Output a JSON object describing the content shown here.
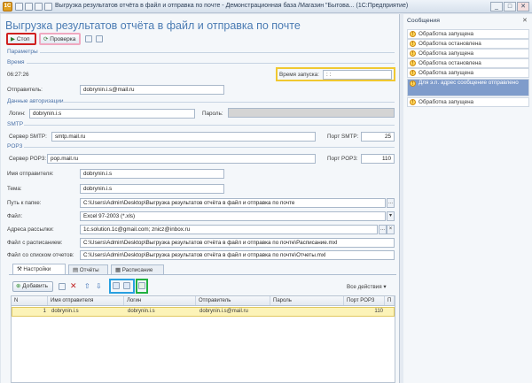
{
  "window": {
    "title": "Выгрузка результатов отчёта в файл и отправка по почте - Демонстрационная база /Магазин \"Бытова...  (1С:Предприятие)",
    "app_icon": "1С",
    "min": "_",
    "max": "□",
    "close": "✕"
  },
  "form": {
    "title": "Выгрузка результатов отчёта в файл и отправка по почте",
    "stop_button": "Стоп",
    "check_button": "Проверка",
    "params_section": "Параметры",
    "time_section": "Время",
    "current_time": "06:27:26",
    "start_time_label": "Время запуска:",
    "start_time_value": ":  :",
    "sender_label": "Отправитель:",
    "sender_value": "dobrynin.i.s@mail.ru",
    "auth_section": "Данные авторизации",
    "login_label": "Логин:",
    "login_value": "dobrynin.i.s",
    "password_label": "Пароль:",
    "smtp_section": "SMTP",
    "smtp_server_label": "Сервер SMTP:",
    "smtp_server_value": "smtp.mail.ru",
    "smtp_port_label": "Порт SMTP:",
    "smtp_port_value": "25",
    "pop3_section": "POP3",
    "pop3_server_label": "Сервер POP3:",
    "pop3_server_value": "pop.mail.ru",
    "pop3_port_label": "Порт POP3:",
    "pop3_port_value": "110",
    "sender_name_label": "Имя отправителя:",
    "sender_name_value": "dobrynin.i.s",
    "subject_label": "Тема:",
    "subject_value": "dobrynin.i.s",
    "folder_label": "Путь к папке:",
    "folder_value": "C:\\Users\\Admin\\Desktop\\Выгрузка результатов отчёта в файл и отправка по почте",
    "file_label": "Файл:",
    "file_value": "Excel 97-2003 (*.xls)",
    "recipients_label": "Адреса рассылки:",
    "recipients_value": "1c.solution.1c@gmail.com;  znicz@inbox.ru",
    "schedule_file_label": "Файл с расписанием:",
    "schedule_file_value": "C:\\Users\\Admin\\Desktop\\Выгрузка результатов отчёта в файл и отправка по почте\\Расписание.mxl",
    "reports_file_label": "Файл со списком отчетов:",
    "reports_file_value": "C:\\Users\\Admin\\Desktop\\Выгрузка результатов отчёта в файл и отправка по почте\\Отчеты.mxl",
    "select_btn": "...",
    "clear_btn": "×",
    "dropdown_btn": "▾"
  },
  "tabs": [
    {
      "label": "Настройки",
      "active": true
    },
    {
      "label": "Отчёты",
      "active": false
    },
    {
      "label": "Расписание",
      "active": false
    }
  ],
  "grid_toolbar": {
    "add_label": "Добавить",
    "all_actions": "Все действия ▾"
  },
  "grid": {
    "columns": [
      "N",
      "Имя отправителя",
      "Логин",
      "Отправитель",
      "Пароль",
      "Порт POP3",
      "П"
    ],
    "rows": [
      [
        "1",
        "dobrynin.i.s",
        "dobrynin.i.s",
        "dobrynin.i.s@mail.ru",
        "",
        "110",
        ""
      ]
    ]
  },
  "messages": {
    "title": "Сообщения",
    "close": "✕",
    "items": [
      {
        "text": "Обработка запущена",
        "selected": false
      },
      {
        "text": "Обработка остановлена",
        "selected": false
      },
      {
        "text": "Обработка запущена",
        "selected": false
      },
      {
        "text": "Обработка остановлена",
        "selected": false
      },
      {
        "text": "Обработка запущена",
        "selected": false
      },
      {
        "text": "Для э.п. адрес       сообщение отправлено",
        "selected": true
      },
      {
        "text": "Обработка запущена",
        "selected": false
      }
    ]
  },
  "colors": {
    "accent": "#4a7bb3",
    "selection": "#7f9ccb",
    "grid_row": "#fcf3b8"
  }
}
